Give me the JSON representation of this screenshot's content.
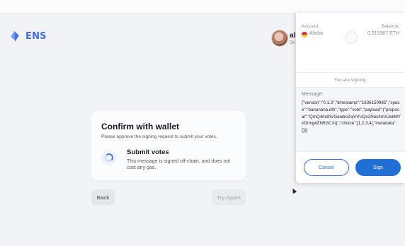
{
  "app": {
    "logo_text": "ENS"
  },
  "user": {
    "name": "al",
    "sub": "0x"
  },
  "confirm": {
    "title": "Confirm with wallet",
    "subtitle": "Please approve the signing request to submit your votes.",
    "submit_title": "Submit votes",
    "submit_desc": "This message is signed off-chain, and does not cost any gas.",
    "back_label": "Back",
    "try_again_label": "Try Again"
  },
  "wallet": {
    "account_label": "Account:",
    "account_name": "Alisha",
    "balance_label": "Balance:",
    "balance_value": "0.215367 ETH",
    "signing_label": "You are signing:",
    "message_label": "Message:",
    "message": "{\"version\":\"0.1.3\",\"timestamp\":\"1636150985\",\"space\":\"bananana.eth\",\"type\":\"vote\",\"payload\":{\"proposal\":\"QmQ4mdhVGawbo2ojVVUQx2Nos4mXJekMYxDrmg4ZN5GCXq\",\"choice\":[1,2,3,4],\"metadata\":{}}}",
    "cancel_label": "Cancel",
    "sign_label": "Sign"
  },
  "colors": {
    "accent": "#3f6ee8",
    "sign_button": "#1f6fd6",
    "background": "#f2f3f6"
  },
  "icons": {
    "logo": "ens-logo-icon",
    "spinner": "loading-spinner-icon",
    "flag": "account-flag-icon"
  }
}
